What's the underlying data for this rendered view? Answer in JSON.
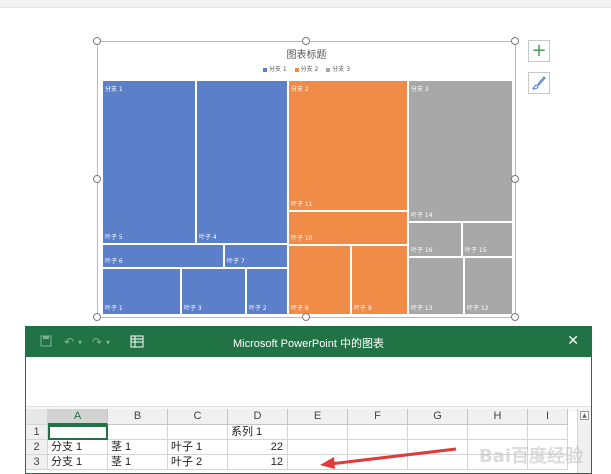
{
  "colors": {
    "branch1": "#5b7fc8",
    "branch2": "#f08b48",
    "branch3": "#a8a8a8",
    "excel_green": "#217346",
    "arrow_red": "#e03a3a"
  },
  "chart": {
    "title": "图表标题",
    "legend": [
      "分支 1",
      "分支 2",
      "分支 3"
    ]
  },
  "chart_data": {
    "type": "treemap",
    "title": "图表标题",
    "legend_position": "top",
    "series": [
      {
        "name": "分支 1",
        "leaves": [
          "叶子 1",
          "叶子 2",
          "叶子 3",
          "叶子 4",
          "叶子 5",
          "叶子 6",
          "叶子 7"
        ]
      },
      {
        "name": "分支 2",
        "leaves": [
          "叶子 8",
          "叶子 9",
          "叶子 10",
          "叶子 11"
        ]
      },
      {
        "name": "分支 3",
        "leaves": [
          "叶子 12",
          "叶子 13",
          "叶子 14",
          "叶子 15",
          "叶子 16"
        ]
      }
    ],
    "tiles": [
      {
        "label": "分支 1",
        "leaf": "叶子 5"
      },
      {
        "label": "",
        "leaf": "叶子 4"
      },
      {
        "label": "",
        "leaf": "叶子 6"
      },
      {
        "label": "",
        "leaf": "叶子 7"
      },
      {
        "label": "",
        "leaf": "叶子 1"
      },
      {
        "label": "",
        "leaf": "叶子 3"
      },
      {
        "label": "",
        "leaf": "叶子 2"
      },
      {
        "label": "分支 2",
        "leaf": "叶子 11"
      },
      {
        "label": "",
        "leaf": "叶子 10"
      },
      {
        "label": "",
        "leaf": "叶子 8"
      },
      {
        "label": "",
        "leaf": "叶子 9"
      },
      {
        "label": "分支 3",
        "leaf": "叶子 14"
      },
      {
        "label": "",
        "leaf": "叶子 16"
      },
      {
        "label": "",
        "leaf": "叶子 15"
      },
      {
        "label": "",
        "leaf": "叶子 13"
      },
      {
        "label": "",
        "leaf": "叶子 12"
      }
    ]
  },
  "side_buttons": {
    "add_icon": "plus-icon",
    "style_icon": "brush-icon"
  },
  "excel": {
    "title": "Microsoft PowerPoint 中的图表",
    "close_label": "✕",
    "quick_access": [
      "save-icon",
      "undo-icon",
      "redo-icon",
      "sheet-icon"
    ],
    "columns": [
      "A",
      "B",
      "C",
      "D",
      "E",
      "F",
      "G",
      "H",
      "I"
    ],
    "rows": [
      {
        "num": "1",
        "cells": [
          "",
          "",
          "",
          "系列 1",
          "",
          "",
          "",
          "",
          ""
        ]
      },
      {
        "num": "2",
        "cells": [
          "分支 1",
          "茎 1",
          "叶子 1",
          "22",
          "",
          "",
          "",
          "",
          ""
        ]
      },
      {
        "num": "3",
        "cells": [
          "分支 1",
          "茎 1",
          "叶子 2",
          "12",
          "",
          "",
          "",
          "",
          ""
        ]
      }
    ]
  },
  "watermark": "Bai百度经验"
}
